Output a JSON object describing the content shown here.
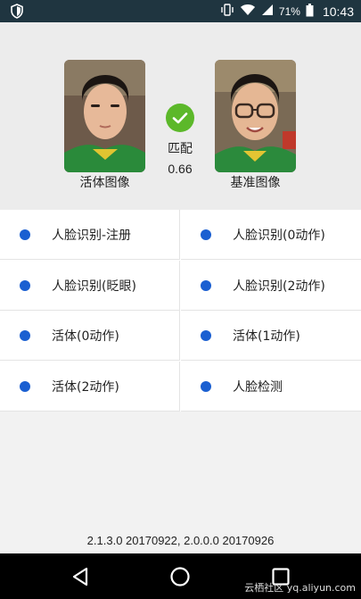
{
  "status_bar": {
    "battery_percent": "71%",
    "time": "10:43",
    "icons": [
      "shield-icon",
      "vibrate-icon",
      "wifi-icon",
      "signal-icon",
      "battery-icon"
    ]
  },
  "compare": {
    "live_caption": "活体图像",
    "reference_caption": "基准图像",
    "match_label": "匹配",
    "match_score": "0.66",
    "match_color": "#5cb82a"
  },
  "menu": {
    "items": [
      {
        "label": "人脸识别-注册"
      },
      {
        "label": "人脸识别(0动作)"
      },
      {
        "label": "人脸识别(眨眼)"
      },
      {
        "label": "人脸识别(2动作)"
      },
      {
        "label": "活体(0动作)"
      },
      {
        "label": "活体(1动作)"
      },
      {
        "label": "活体(2动作)"
      },
      {
        "label": "人脸检测"
      }
    ],
    "dot_color": "#1a5fd1"
  },
  "version": "2.1.3.0 20170922, 2.0.0.0 20170926",
  "watermark": "云栖社区 yq.aliyun.com"
}
